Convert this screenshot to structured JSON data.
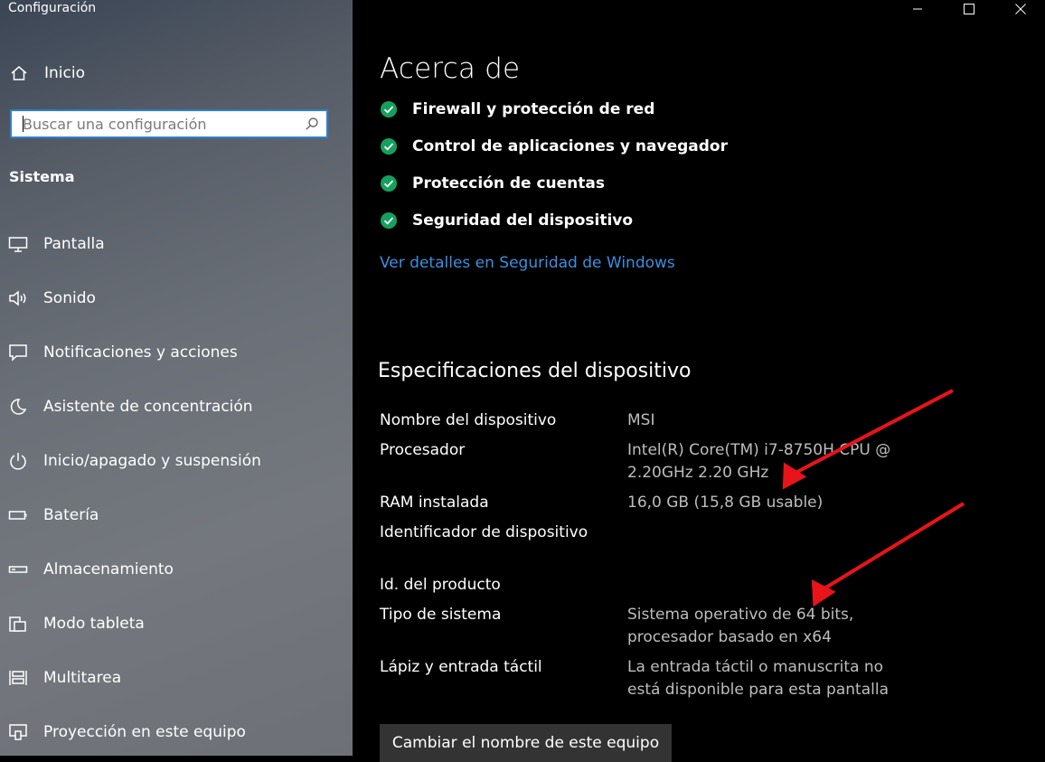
{
  "app": {
    "title": "Configuración"
  },
  "sidebar": {
    "home_label": "Inicio",
    "search": {
      "placeholder": "Buscar una configuración",
      "value": ""
    },
    "section_title": "Sistema",
    "items": [
      {
        "label": "Pantalla",
        "icon": "monitor-icon"
      },
      {
        "label": "Sonido",
        "icon": "speaker-icon"
      },
      {
        "label": "Notificaciones y acciones",
        "icon": "notification-icon"
      },
      {
        "label": "Asistente de concentración",
        "icon": "moon-icon"
      },
      {
        "label": "Inicio/apagado y suspensión",
        "icon": "power-icon"
      },
      {
        "label": "Batería",
        "icon": "battery-icon"
      },
      {
        "label": "Almacenamiento",
        "icon": "storage-icon"
      },
      {
        "label": "Modo tableta",
        "icon": "tablet-icon"
      },
      {
        "label": "Multitarea",
        "icon": "multitask-icon"
      },
      {
        "label": "Proyección en este equipo",
        "icon": "projection-icon"
      }
    ]
  },
  "main": {
    "title": "Acerca de",
    "security_items": [
      "Firewall y protección de red",
      "Control de aplicaciones y navegador",
      "Protección de cuentas",
      "Seguridad del dispositivo"
    ],
    "security_link": "Ver detalles en Seguridad de Windows",
    "specs_title": "Especificaciones del dispositivo",
    "specs": [
      {
        "label": "Nombre del dispositivo",
        "value": "MSI"
      },
      {
        "label": "Procesador",
        "value": "Intel(R) Core(TM) i7-8750H CPU @\n2.20GHz   2.20 GHz"
      },
      {
        "label": "RAM instalada",
        "value": "16,0 GB (15,8 GB usable)"
      },
      {
        "label": "Identificador de dispositivo",
        "value": ""
      },
      {
        "label": "Id. del producto",
        "value": ""
      },
      {
        "label": "Tipo de sistema",
        "value": "Sistema operativo de 64 bits,\nprocesador basado en x64"
      },
      {
        "label": "Lápiz y entrada táctil",
        "value": "La entrada táctil o manuscrita no\nestá disponible para esta pantalla"
      }
    ],
    "rename_button": "Cambiar el nombre de este equipo"
  },
  "colors": {
    "accent": "#2f7fd1",
    "link": "#3d8fdf",
    "check": "#16a05f",
    "annotation": "#e8141a"
  }
}
